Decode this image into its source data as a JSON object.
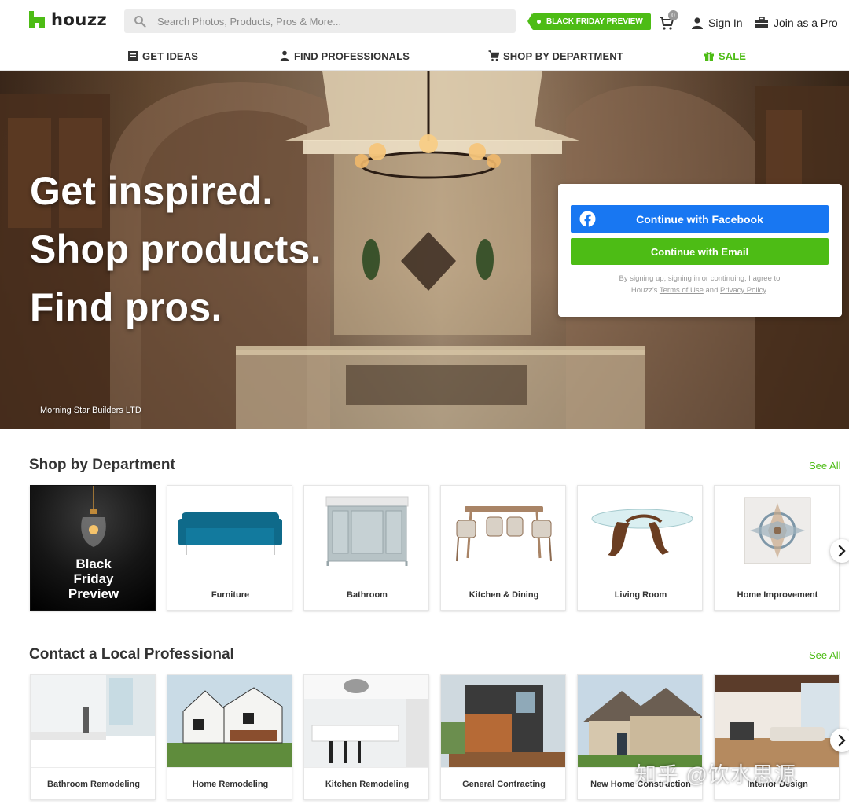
{
  "header": {
    "logo_text": "houzz",
    "search_placeholder": "Search Photos, Products, Pros & More...",
    "promo_label": "BLACK FRIDAY PREVIEW",
    "cart_count": "0",
    "sign_in_label": "Sign In",
    "join_pro_label": "Join as a Pro"
  },
  "nav": {
    "items": [
      {
        "label": "GET IDEAS",
        "icon": "idea-book-icon"
      },
      {
        "label": "FIND PROFESSIONALS",
        "icon": "professional-icon"
      },
      {
        "label": "SHOP BY DEPARTMENT",
        "icon": "shopping-cart-icon"
      },
      {
        "label": "SALE",
        "icon": "gift-icon"
      }
    ]
  },
  "hero": {
    "headline": [
      "Get inspired.",
      "Shop products.",
      "Find pros."
    ],
    "photo_credit": "Morning Star Builders LTD"
  },
  "signup": {
    "facebook_label": "Continue with Facebook",
    "email_label": "Continue with Email",
    "legal_line1": "By signing up, signing in or continuing, I agree to",
    "legal_prefix": "Houzz's",
    "terms_label": "Terms of Use",
    "legal_and": "and",
    "privacy_label": "Privacy Policy",
    "legal_suffix": "."
  },
  "shop": {
    "title": "Shop by Department",
    "see_all": "See All",
    "promo_card": [
      "Black",
      "Friday",
      "Preview"
    ],
    "departments": [
      "Furniture",
      "Bathroom",
      "Kitchen & Dining",
      "Living Room",
      "Home Improvement"
    ]
  },
  "pros": {
    "title": "Contact a Local Professional",
    "see_all": "See All",
    "categories": [
      "Bathroom Remodeling",
      "Home Remodeling",
      "Kitchen Remodeling",
      "General Contracting",
      "New Home Construction",
      "Interior Design"
    ]
  },
  "watermark": "知乎 @饮水思源",
  "colors": {
    "brand_green": "#4dbc15",
    "facebook_blue": "#1877f2",
    "text_dark": "#333333"
  }
}
